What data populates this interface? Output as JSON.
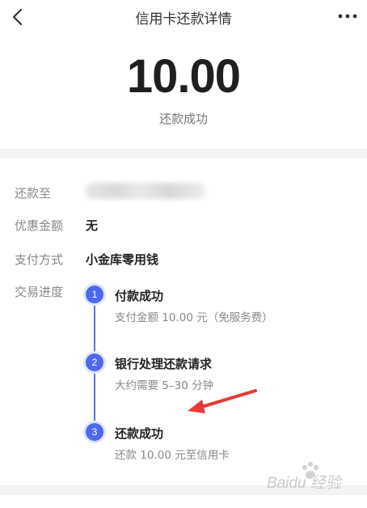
{
  "nav": {
    "back_icon": "chevron-left-icon",
    "title": "信用卡还款详情",
    "more_icon": "more-horizontal-icon"
  },
  "summary": {
    "amount": "10.00",
    "status": "还款成功"
  },
  "details": {
    "repay_to_label": "还款至",
    "discount_label": "优惠金额",
    "discount_value": "无",
    "payment_method_label": "支付方式",
    "payment_method_value": "小金库零用钱",
    "progress_label": "交易进度"
  },
  "progress": {
    "steps": [
      {
        "number": "1",
        "title": "付款成功",
        "desc": "支付金额 10.00 元（免服务费）"
      },
      {
        "number": "2",
        "title": "银行处理还款请求",
        "desc": "大约需要 5–30 分钟"
      },
      {
        "number": "3",
        "title": "还款成功",
        "desc": "还款 10.00 元至信用卡"
      }
    ]
  },
  "watermark": {
    "text": "Baidu 经验"
  },
  "colors": {
    "accent": "#4d68ec",
    "annotation_arrow": "#e53935",
    "muted_text": "#888888"
  }
}
